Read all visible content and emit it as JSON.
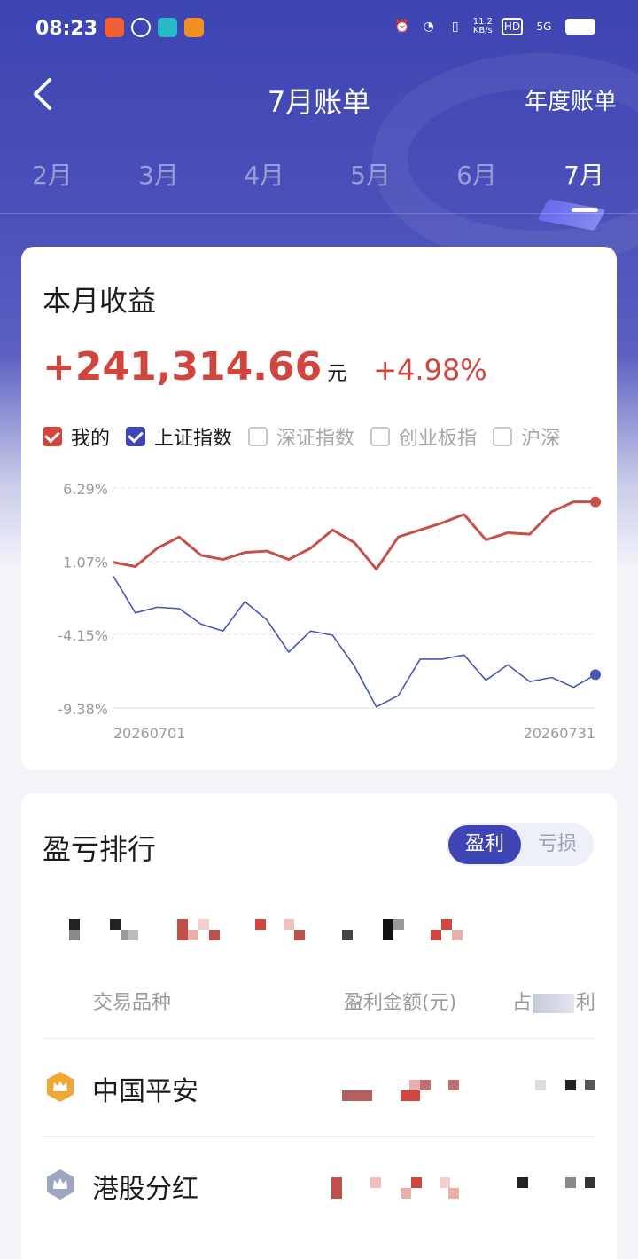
{
  "status_bar": {
    "time": "08:23",
    "net_speed_value": "11.2",
    "net_speed_unit": "KB/s",
    "hd": "HD",
    "network": "5G"
  },
  "nav": {
    "back_icon": "chevron-left-icon",
    "title": "7月账单",
    "annual_link": "年度账单"
  },
  "months": [
    "2月",
    "3月",
    "4月",
    "5月",
    "6月",
    "7月"
  ],
  "selected_month": "7月",
  "income_card": {
    "title": "本月收益",
    "profit_value": "+241,314.66",
    "profit_unit": "元",
    "profit_pct": "+4.98%",
    "legend": [
      {
        "label": "我的",
        "checked": true,
        "color": "#d0463f"
      },
      {
        "label": "上证指数",
        "checked": true,
        "color": "#3f45b4"
      },
      {
        "label": "深证指数",
        "checked": false,
        "color": "#c8c8c8"
      },
      {
        "label": "创业板指",
        "checked": false,
        "color": "#c8c8c8"
      },
      {
        "label": "沪深",
        "checked": false,
        "color": "#c8c8c8"
      }
    ]
  },
  "chart_data": {
    "type": "line",
    "y_ticks": [
      "6.29%",
      "1.07%",
      "-4.15%",
      "-9.38%"
    ],
    "ylim": [
      -9.38,
      6.29
    ],
    "x_labels": [
      "20260701",
      "20260731"
    ],
    "series": [
      {
        "name": "我的",
        "color": "#c8504a",
        "values": [
          1.0,
          0.7,
          2.0,
          2.8,
          1.5,
          1.2,
          1.7,
          1.8,
          1.2,
          2.0,
          3.3,
          2.4,
          0.5,
          2.8,
          3.3,
          3.8,
          4.4,
          2.6,
          3.1,
          3.0,
          4.6,
          5.3,
          5.3
        ]
      },
      {
        "name": "上证指数",
        "color": "#4a55b8",
        "values": [
          0.0,
          -2.6,
          -2.2,
          -2.3,
          -3.4,
          -3.9,
          -1.8,
          -3.1,
          -5.4,
          -3.9,
          -4.2,
          -6.4,
          -9.3,
          -8.5,
          -5.9,
          -5.9,
          -5.6,
          -7.4,
          -6.3,
          -7.5,
          -7.2,
          -7.9,
          -7.0
        ]
      }
    ],
    "grid": true
  },
  "ranking_card": {
    "title": "盈亏排行",
    "toggle": {
      "on": "盈利",
      "off": "亏损"
    },
    "columns": [
      "交易品种",
      "盈利金额(元)",
      "占",
      "利"
    ],
    "rows": [
      {
        "name": "中国平安",
        "medal": "gold-crown-medal-icon"
      },
      {
        "name": "港股分红",
        "medal": "silver-crown-medal-icon"
      }
    ]
  },
  "colors": {
    "brand": "#3f45b4",
    "profit_red": "#d0463f",
    "gold": "#f0a830",
    "silver": "#9fa6c2"
  }
}
